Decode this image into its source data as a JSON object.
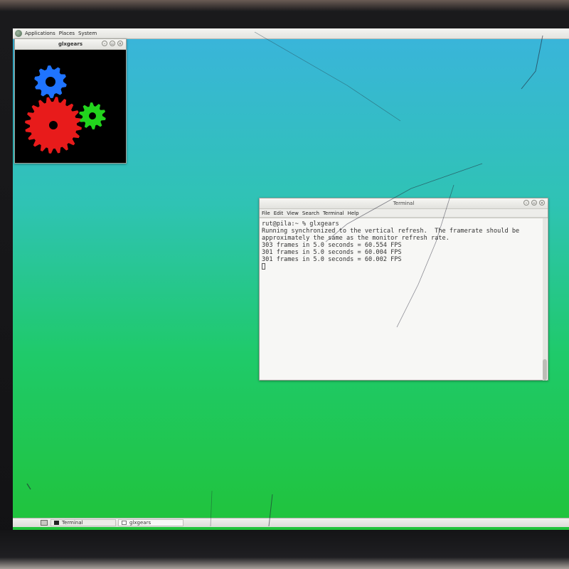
{
  "top_panel": {
    "icon": "distro-logo-icon",
    "menus": [
      "Applications",
      "Places",
      "System"
    ]
  },
  "glxgears_window": {
    "title": "glxgears",
    "buttons": [
      "minimize-icon",
      "maximize-icon",
      "close-icon"
    ],
    "gear_colors": {
      "red": "#e81b1b",
      "green": "#22d41d",
      "blue": "#1f74ff"
    }
  },
  "terminal_window": {
    "title": "Terminal",
    "menus": [
      "File",
      "Edit",
      "View",
      "Search",
      "Terminal",
      "Help"
    ],
    "lines": [
      "rut@pila:~ % glxgears",
      "Running synchronized to the vertical refresh.  The framerate should be",
      "approximately the same as the monitor refresh rate.",
      "303 frames in 5.0 seconds = 60.554 FPS",
      "301 frames in 5.0 seconds = 60.004 FPS",
      "301 frames in 5.0 seconds = 60.002 FPS"
    ]
  },
  "taskbar": {
    "tasks": [
      {
        "label": "Terminal",
        "icon": "terminal-icon"
      },
      {
        "label": "glxgears",
        "icon": "window-icon"
      }
    ]
  },
  "colors": {
    "desktop_top": "#3ab4dc",
    "desktop_bottom": "#20c33a"
  }
}
